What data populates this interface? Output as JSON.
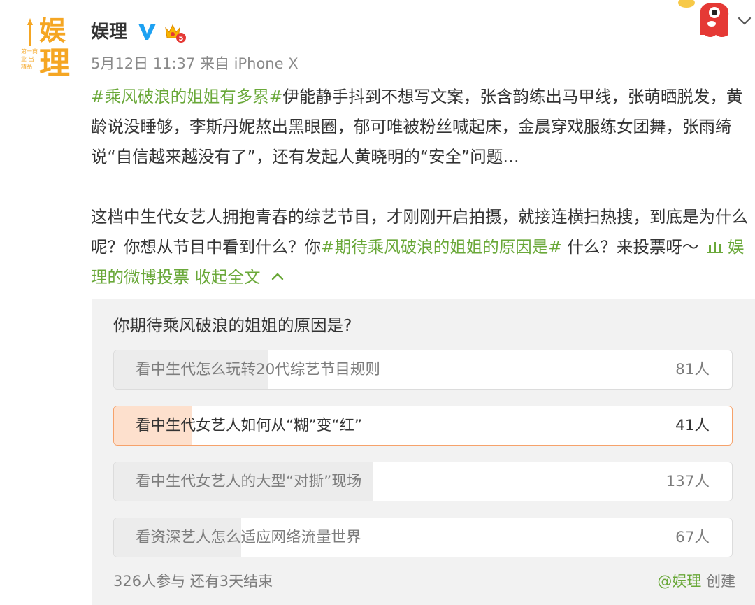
{
  "account": {
    "name": "娱理",
    "avatar_text_top": "娱",
    "avatar_text_bottom": "理",
    "avatar_side_text": "第一商业 出精品",
    "verified_icon": "v-verified-icon",
    "member_icon": "member-level-icon",
    "member_level": "5"
  },
  "post": {
    "date": "5月12日 11:37",
    "source_prefix": "来自",
    "source": "iPhone X",
    "hashtag1": "#乘风破浪的姐姐有多累#",
    "body1": "伊能静手抖到不想写文案，张含韵练出马甲线，张萌晒脱发，黄龄说没睡够，李斯丹妮熬出黑眼圈，郁可唯被粉丝喊起床，金晨穿戏服练女团舞，张雨绮说“自信越来越没有了”，还有发起人黄晓明的“安全”问题…",
    "body2_a": "这档中生代女艺人拥抱青春的综艺节目，才刚刚开启拍摄，就接连横扫热搜，到底是为什么呢？你想从节目中看到什么？你",
    "hashtag2": "#期待乘风破浪的姐姐的原因是#",
    "body2_b": " 什么？来投票呀～ ",
    "vote_link_icon": "poll-chart-icon",
    "vote_link": "娱理的微博投票",
    "collapse_label": "收起全文",
    "collapse_icon": "chevron-up-icon"
  },
  "poll": {
    "question": "你期待乘风破浪的姐姐的原因是?",
    "options": [
      {
        "label": "看中生代怎么玩转20代综艺节目规则",
        "count": "81人",
        "votes": 81,
        "selected": false
      },
      {
        "label": "看中生代女艺人如何从“糊”变“红”",
        "count": "41人",
        "votes": 41,
        "selected": true
      },
      {
        "label": "看中生代女艺人的大型“对撕”现场",
        "count": "137人",
        "votes": 137,
        "selected": false
      },
      {
        "label": "看资深艺人怎么适应网络流量世界",
        "count": "67人",
        "votes": 67,
        "selected": false
      }
    ],
    "participants": "326人参与",
    "remaining": "还有3天结束",
    "creator": "@娱理",
    "created_label": "创建"
  },
  "colors": {
    "accent_green": "#6aa839",
    "selected_border": "#f6a26b",
    "selected_fill": "#fde0cd"
  }
}
